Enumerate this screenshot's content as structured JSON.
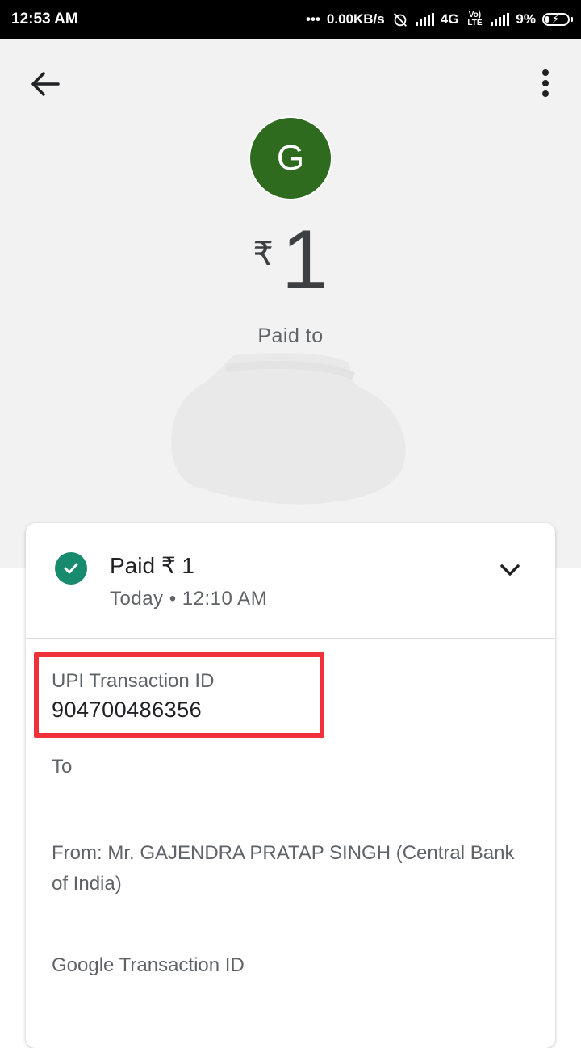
{
  "status_bar": {
    "time": "12:53 AM",
    "dots": "•••",
    "network_speed": "0.00KB/s",
    "network_type": "4G",
    "volte": "Vo) LTE",
    "battery": "9%"
  },
  "header": {
    "back_icon": "arrow-back-icon",
    "menu_icon": "more-vert-icon"
  },
  "payee": {
    "avatar_letter": "G",
    "avatar_color": "#2e6b1e",
    "currency": "₹",
    "amount": "1",
    "paid_to_label": "Paid to"
  },
  "card": {
    "status_title": "Paid ₹ 1",
    "status_time": "Today • 12:10 AM",
    "status_icon": "check-circle-icon",
    "status_color": "#188a6e",
    "expand_icon": "chevron-down-icon",
    "upi_label": "UPI Transaction ID",
    "upi_value": "904700486356",
    "highlight_color": "#f0313a",
    "to_label": "To",
    "from_text": "From: Mr. GAJENDRA PRATAP SINGH (Central Bank of India)",
    "google_txn_label": "Google Transaction ID"
  }
}
